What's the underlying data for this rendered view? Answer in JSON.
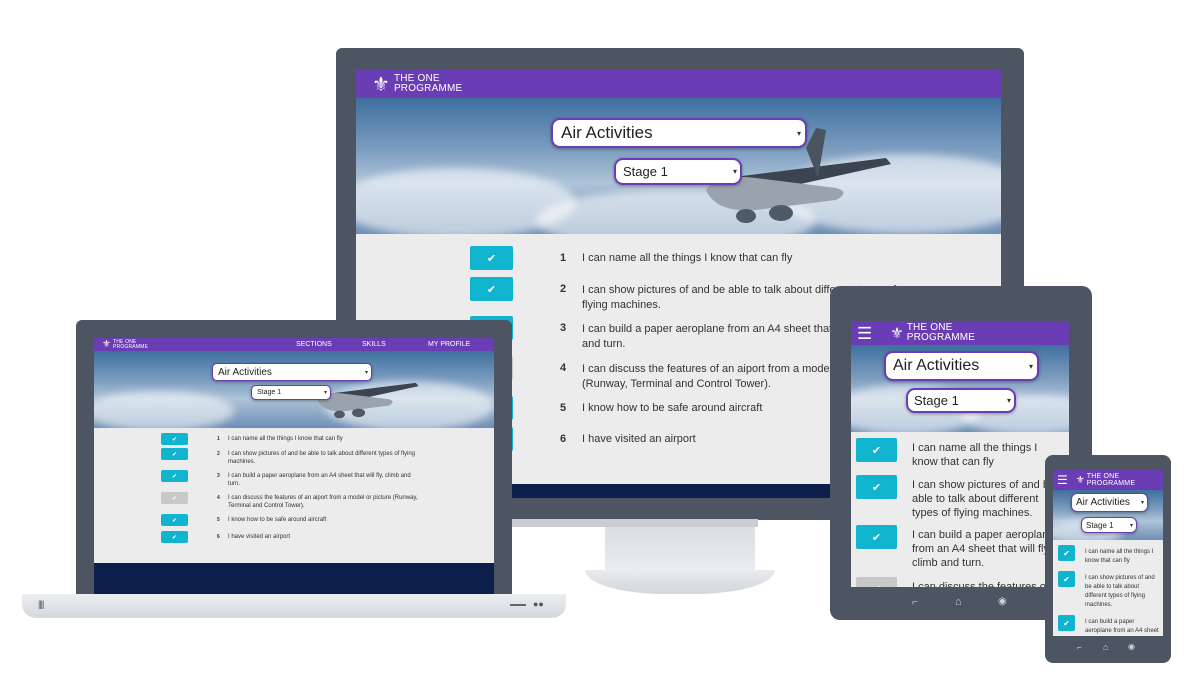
{
  "brand": {
    "line1": "THE ONE",
    "line2": "PROGRAMME"
  },
  "nav": {
    "sections": "SECTIONS",
    "skills": "SKILLS",
    "profile": "MY PROFILE"
  },
  "activity_select": {
    "value": "Air Activities"
  },
  "stage_select": {
    "value": "Stage 1"
  },
  "checkmark": "✔",
  "items": [
    {
      "num": "1",
      "text": "I can name all the things I know that can fly",
      "done": true
    },
    {
      "num": "2",
      "text": "I can show pictures of and be able to talk about different types of flying machines.",
      "done": true
    },
    {
      "num": "3",
      "text": "I can build a paper aeroplane from an A4 sheet that will fly, climb and turn.",
      "done": true
    },
    {
      "num": "4",
      "text": "I can discuss the features of an aiport from a model or picture (Runway, Terminal and Control Tower).",
      "done": false
    },
    {
      "num": "5",
      "text": "I know how to be safe around aircraft",
      "done": true
    },
    {
      "num": "6",
      "text": "I have visited an airport",
      "done": true
    }
  ],
  "desktop_items_visible": [
    "I can name all the things I know that can fly",
    "I can show pictures of and be able to talk about different types of",
    "flying machines.",
    "I can build a paper aeroplane from an A4 sheet that will fly, climb",
    "and turn.",
    "I can discuss the features of an aiport from a model or picture",
    "(Runway, Terminal and Control Tower).",
    "I know how to be safe around aircraft",
    "I have visited an airport"
  ],
  "colors": {
    "brand_purple": "#6a3db5",
    "check_teal": "#11b4cf",
    "footer_navy": "#0c1e4a",
    "device_frame": "#4d5563"
  }
}
